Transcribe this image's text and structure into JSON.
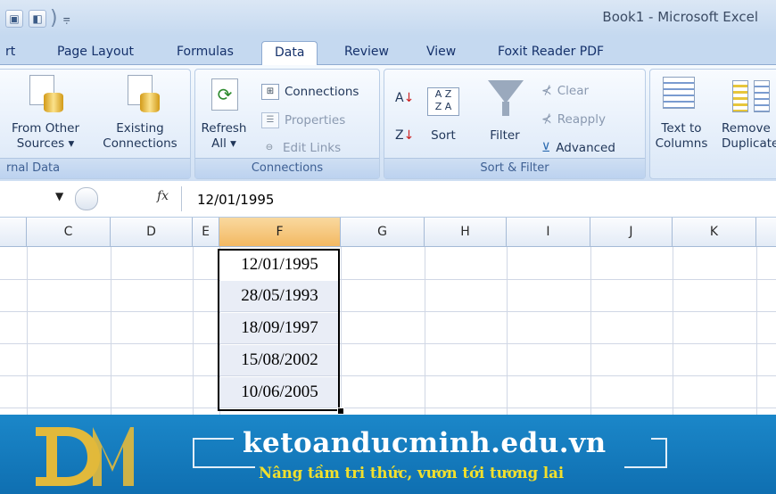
{
  "window": {
    "title": "Book1 - Microsoft Excel"
  },
  "tabs": [
    {
      "label": "rt"
    },
    {
      "label": "Page Layout"
    },
    {
      "label": "Formulas"
    },
    {
      "label": "Data",
      "active": true
    },
    {
      "label": "Review"
    },
    {
      "label": "View"
    },
    {
      "label": "Foxit Reader PDF"
    }
  ],
  "ribbon": {
    "external_data": {
      "label": "rnal Data",
      "from_other_sources": [
        "From Other",
        "Sources ▾"
      ],
      "existing_connections": [
        "Existing",
        "Connections"
      ]
    },
    "connections": {
      "label": "Connections",
      "refresh_all": [
        "Refresh",
        "All ▾"
      ],
      "connections": "Connections",
      "properties": "Properties",
      "edit_links": "Edit Links"
    },
    "sort_filter": {
      "label": "Sort & Filter",
      "sort": "Sort",
      "filter": "Filter",
      "clear": "Clear",
      "reapply": "Reapply",
      "advanced": "Advanced"
    },
    "data_tools": {
      "text_to_columns": [
        "Text to",
        "Columns"
      ],
      "remove_duplicates": [
        "Remove",
        "Duplicates"
      ]
    }
  },
  "formula_bar": {
    "fx": "fx",
    "value": "12/01/1995"
  },
  "columns": [
    "C",
    "D",
    "E",
    "F",
    "G",
    "H",
    "I",
    "J",
    "K"
  ],
  "selected_column": "F",
  "cells_F": [
    "12/01/1995",
    "28/05/1993",
    "18/09/1997",
    "15/08/2002",
    "10/06/2005"
  ],
  "banner": {
    "brand": "ketoanducminh.edu.vn",
    "tagline": "Nâng tầm tri thức, vươn tới tương lai",
    "colors": {
      "background": "#1279bc",
      "tagline": "#f2e02c",
      "logo": "#e2b93b"
    }
  }
}
